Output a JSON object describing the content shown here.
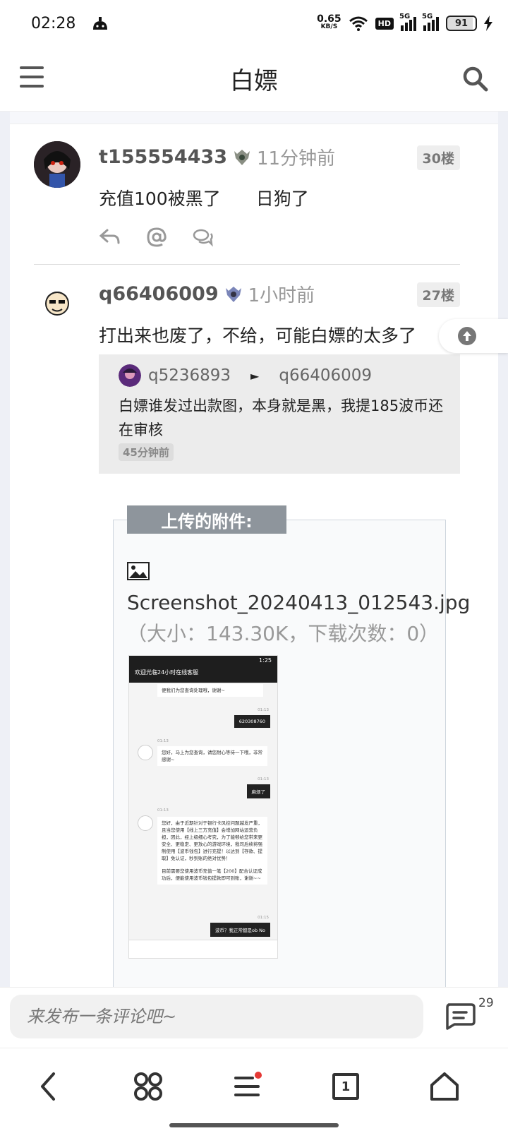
{
  "status_bar": {
    "time": "02:28",
    "net_speed_value": "0.65",
    "net_speed_unit": "KB/S",
    "hd_label": "HD",
    "signal1_label": "5G",
    "signal2_label": "5G",
    "battery": "91"
  },
  "header": {
    "title": "白嫖",
    "menu_icon": "hamburger-icon",
    "search_icon": "search-icon"
  },
  "posts": [
    {
      "username": "t155554433",
      "time_ago": "11分钟前",
      "floor": "30楼",
      "text": "充值100被黑了　　日狗了"
    },
    {
      "username": "q66406009",
      "time_ago": "1小时前",
      "floor": "27楼",
      "text": "打出来也废了，不给，可能白嫖的太多了",
      "quote": {
        "from_user": "q5236893",
        "arrow": "►",
        "to_user": "q66406009",
        "text": "白嫖谁发过出款图，本身就是黑，我提185波币还在审核",
        "time": "45分钟前"
      }
    }
  ],
  "attachment": {
    "title": "上传的附件:",
    "file_name": "Screenshot_20240413_012543.jpg",
    "size_info": "（大小：143.30K，下载次数：0）",
    "screenshot": {
      "title": "欢迎光临24小时在线客服",
      "time": "1:25",
      "msg_top": "便我们为您查询处理哦，谢谢~",
      "t1": "01:13",
      "user_msg1": "620308760",
      "t2": "01:13",
      "agent_msg1": "您好，马上为您查询，请您耐心等待一下哦，非常感谢~",
      "t3": "01:13",
      "user_msg2": "麻烦了",
      "t4": "01:13",
      "agent_msg2": "您好，由于近期针对于银行卡风控问题越发严重，且当您使用【线上三方充值】会增加网站运营负担，因此，经上级细心考究，为了能够给您带来更安全、更稳定、更放心的游戏环境，我司后续将强制使用【波币钱包】进行充提！以达到【存款、提取】免认证，秒到账的绝对优势！",
      "agent_msg2b": "目前需要您使用波币充值一笔【200】配合认证成功后，便能使用波币钱包提款即可到账，谢谢~~",
      "t5": "01:15",
      "user_msg3": "波币？我正常都是ob No"
    }
  },
  "comment_bar": {
    "placeholder": "来发布一条评论吧~",
    "count": "29"
  },
  "bottom_nav": {
    "tab_count": "1"
  }
}
